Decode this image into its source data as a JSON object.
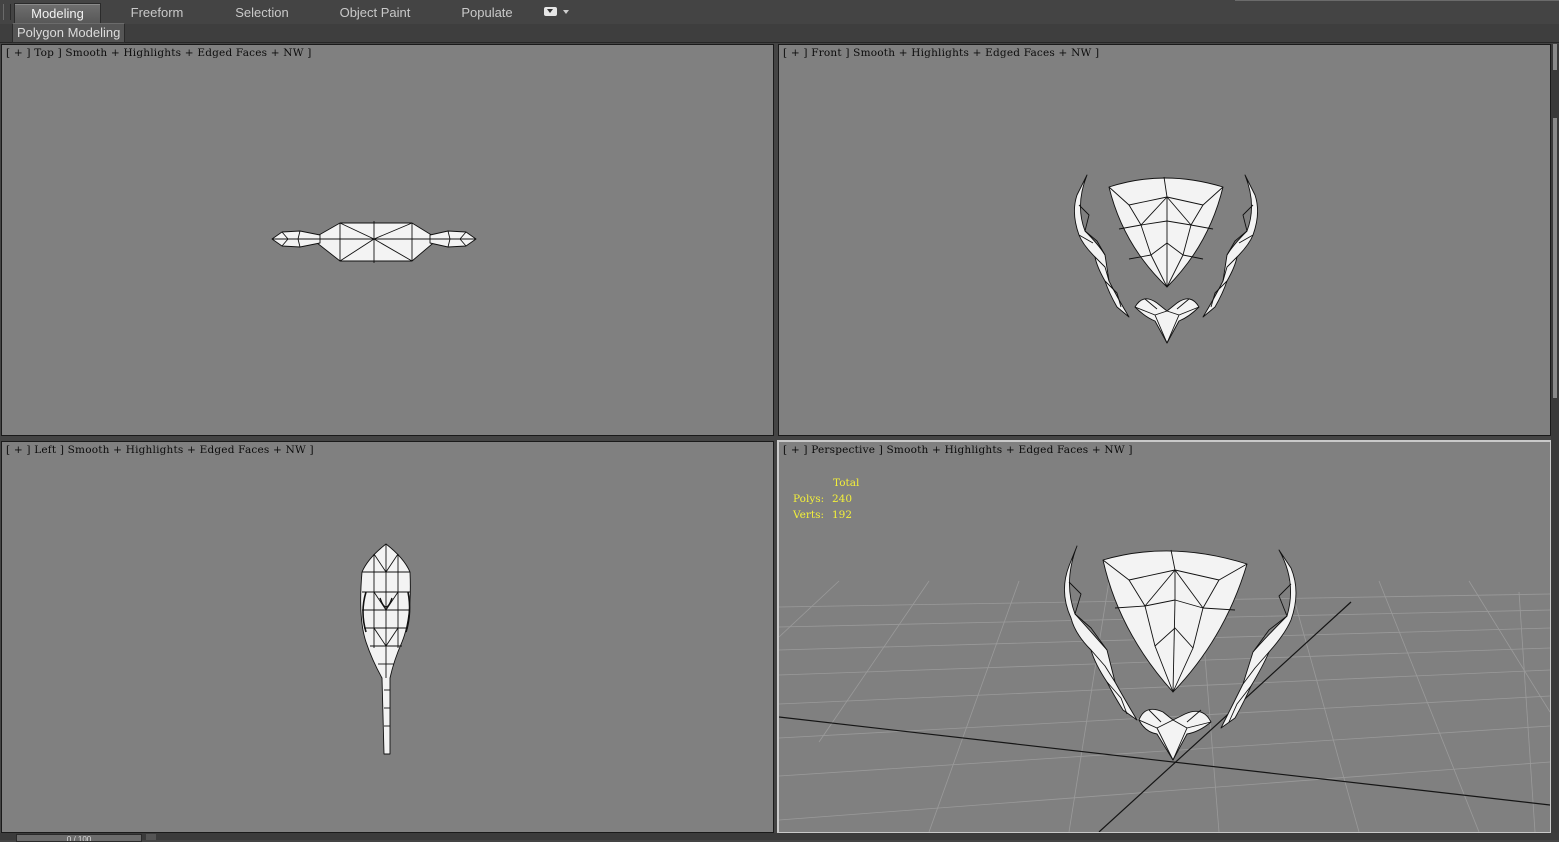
{
  "ribbon": {
    "tabs": [
      {
        "label": "Modeling",
        "active": true
      },
      {
        "label": "Freeform",
        "active": false
      },
      {
        "label": "Selection",
        "active": false
      },
      {
        "label": "Object Paint",
        "active": false
      },
      {
        "label": "Populate",
        "active": false
      }
    ],
    "panel_label": "Polygon Modeling"
  },
  "viewports": {
    "top": {
      "label": "[ + ] Top ] Smooth + Highlights + Edged Faces + NW ]"
    },
    "front": {
      "label": "[ + ] Front ] Smooth + Highlights + Edged Faces + NW ]"
    },
    "left": {
      "label": "[ + ] Left ] Smooth + Highlights + Edged Faces + NW ]"
    },
    "perspective": {
      "label": "[ + ] Perspective ] Smooth + Highlights + Edged Faces + NW ]"
    }
  },
  "stats": {
    "title": "Total",
    "polys_label": "Polys:",
    "polys_value": "240",
    "verts_label": "Verts:",
    "verts_value": "192"
  },
  "timeline": {
    "frame_text": "0 / 100"
  },
  "colors": {
    "viewport_bg": "#808080",
    "ui_bg": "#444444",
    "stats_text": "#f2ef3a",
    "mesh_fill": "#f4f4f4",
    "wire": "#111111"
  }
}
